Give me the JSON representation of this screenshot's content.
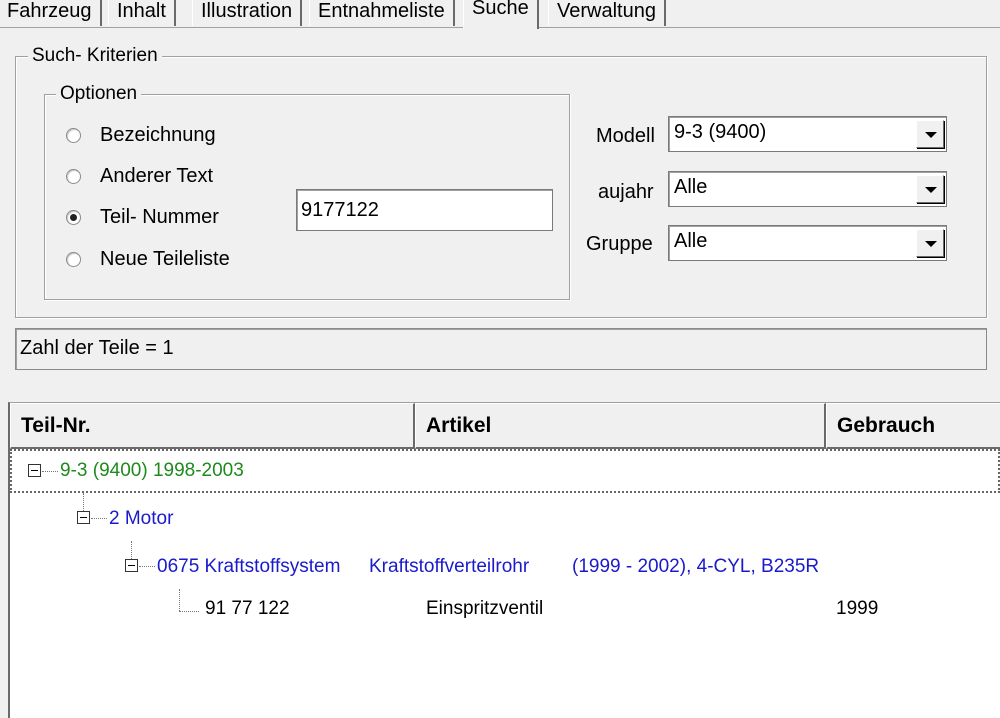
{
  "tabs": [
    "Fahrzeug",
    "Inhalt",
    "Illustration",
    "Entnahmeliste",
    "Suche",
    "Verwaltung"
  ],
  "active_tab": "Suche",
  "criteria": {
    "title": "Such- Kriterien",
    "options_title": "Optionen",
    "options": [
      {
        "label": "Bezeichnung",
        "checked": false
      },
      {
        "label": "Anderer Text",
        "checked": false
      },
      {
        "label": "Teil- Nummer",
        "checked": true
      },
      {
        "label": "Neue Teileliste",
        "checked": false
      }
    ],
    "search_value": "9177122",
    "model_label": "Modell",
    "model_value": "9-3 (9400)",
    "year_label": "aujahr",
    "year_value": "Alle",
    "group_label": "Gruppe",
    "group_value": "Alle"
  },
  "status_text": "Zahl der Teile = 1",
  "columns": [
    "Teil-Nr.",
    "Artikel",
    "Gebrauch"
  ],
  "tree": {
    "root": "9-3 (9400) 1998-2003",
    "level1": "2 Motor",
    "level2_a": "0675 Kraftstoffsystem",
    "level2_b": "Kraftstoffverteilrohr",
    "level2_c": "(1999 - 2002), 4-CYL, B235R",
    "part_number": "91 77 122",
    "part_article": "Einspritzventil",
    "part_usage": "1999"
  },
  "colors": {
    "root": "#1e8a1e",
    "nodes": "#1a1acc"
  }
}
